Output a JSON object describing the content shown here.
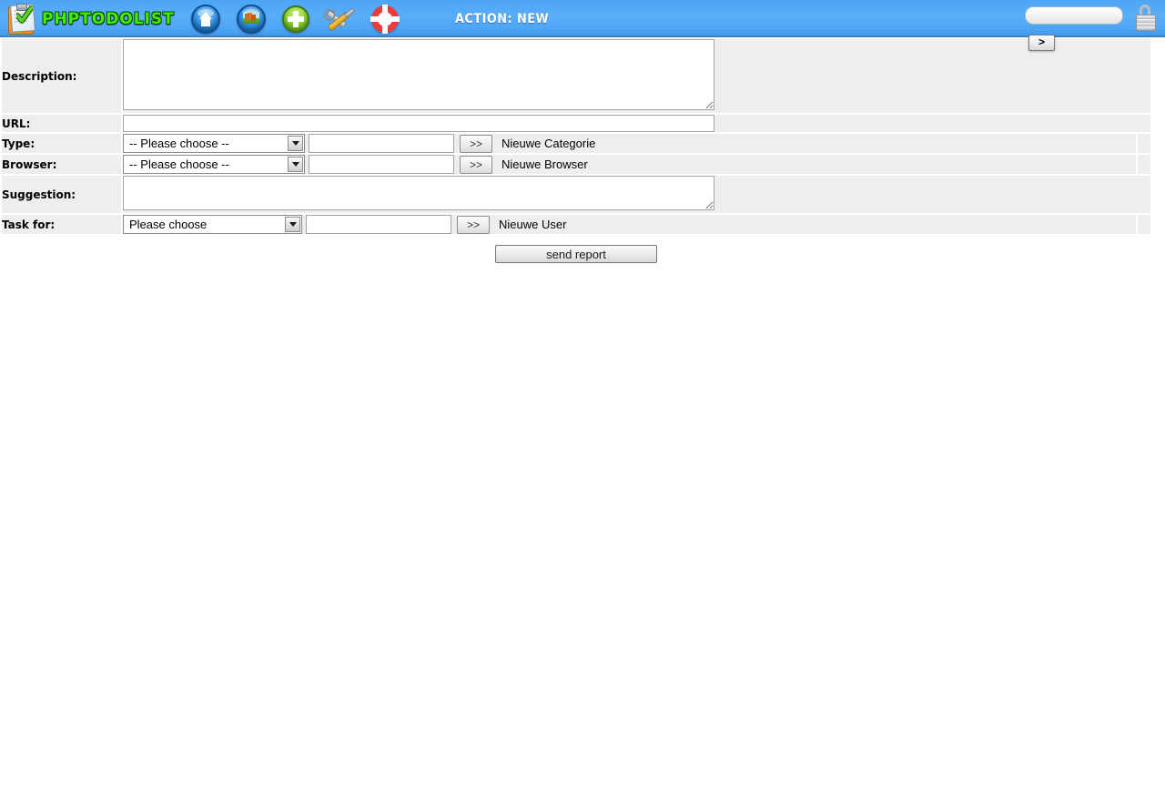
{
  "header": {
    "logo_text": "PHPTODOLIST",
    "logo_icon": "clipboard-check-icon",
    "action_title": "ACTION: NEW",
    "nav": [
      {
        "name": "home",
        "icon": "home-icon",
        "label": "Home"
      },
      {
        "name": "users",
        "icon": "users-group-icon",
        "label": "Users"
      },
      {
        "name": "add",
        "icon": "plus-circle-icon",
        "label": "Add"
      },
      {
        "name": "tools",
        "icon": "tools-icon",
        "label": "Tools"
      },
      {
        "name": "help",
        "icon": "lifebuoy-icon",
        "label": "Help"
      }
    ],
    "search": {
      "value": "",
      "placeholder": ""
    },
    "lock_icon": "padlock-icon",
    "arrow_button_label": ">",
    "colors": {
      "bar_top": "#59aef8",
      "bar_bottom": "#3f97ee",
      "logo_green": "#3ff000",
      "underline": "#c9c2d8"
    }
  },
  "form": {
    "rows": {
      "description": {
        "label": "Description:",
        "value": "",
        "placeholder": ""
      },
      "url": {
        "label": "URL:",
        "value": "",
        "placeholder": ""
      },
      "type": {
        "label": "Type:",
        "select_value": "-- Please choose --",
        "text_value": "",
        "button_label": ">>",
        "note": "Nieuwe Categorie"
      },
      "browser": {
        "label": "Browser:",
        "select_value": "-- Please choose --",
        "text_value": "",
        "button_label": ">>",
        "note": "Nieuwe Browser"
      },
      "suggestion": {
        "label": "Suggestion:",
        "value": "",
        "placeholder": ""
      },
      "task_for": {
        "label": "Task for:",
        "select_value": "Please choose",
        "text_value": "",
        "button_label": ">>",
        "note": "Nieuwe User"
      }
    },
    "submit_label": "send report"
  }
}
